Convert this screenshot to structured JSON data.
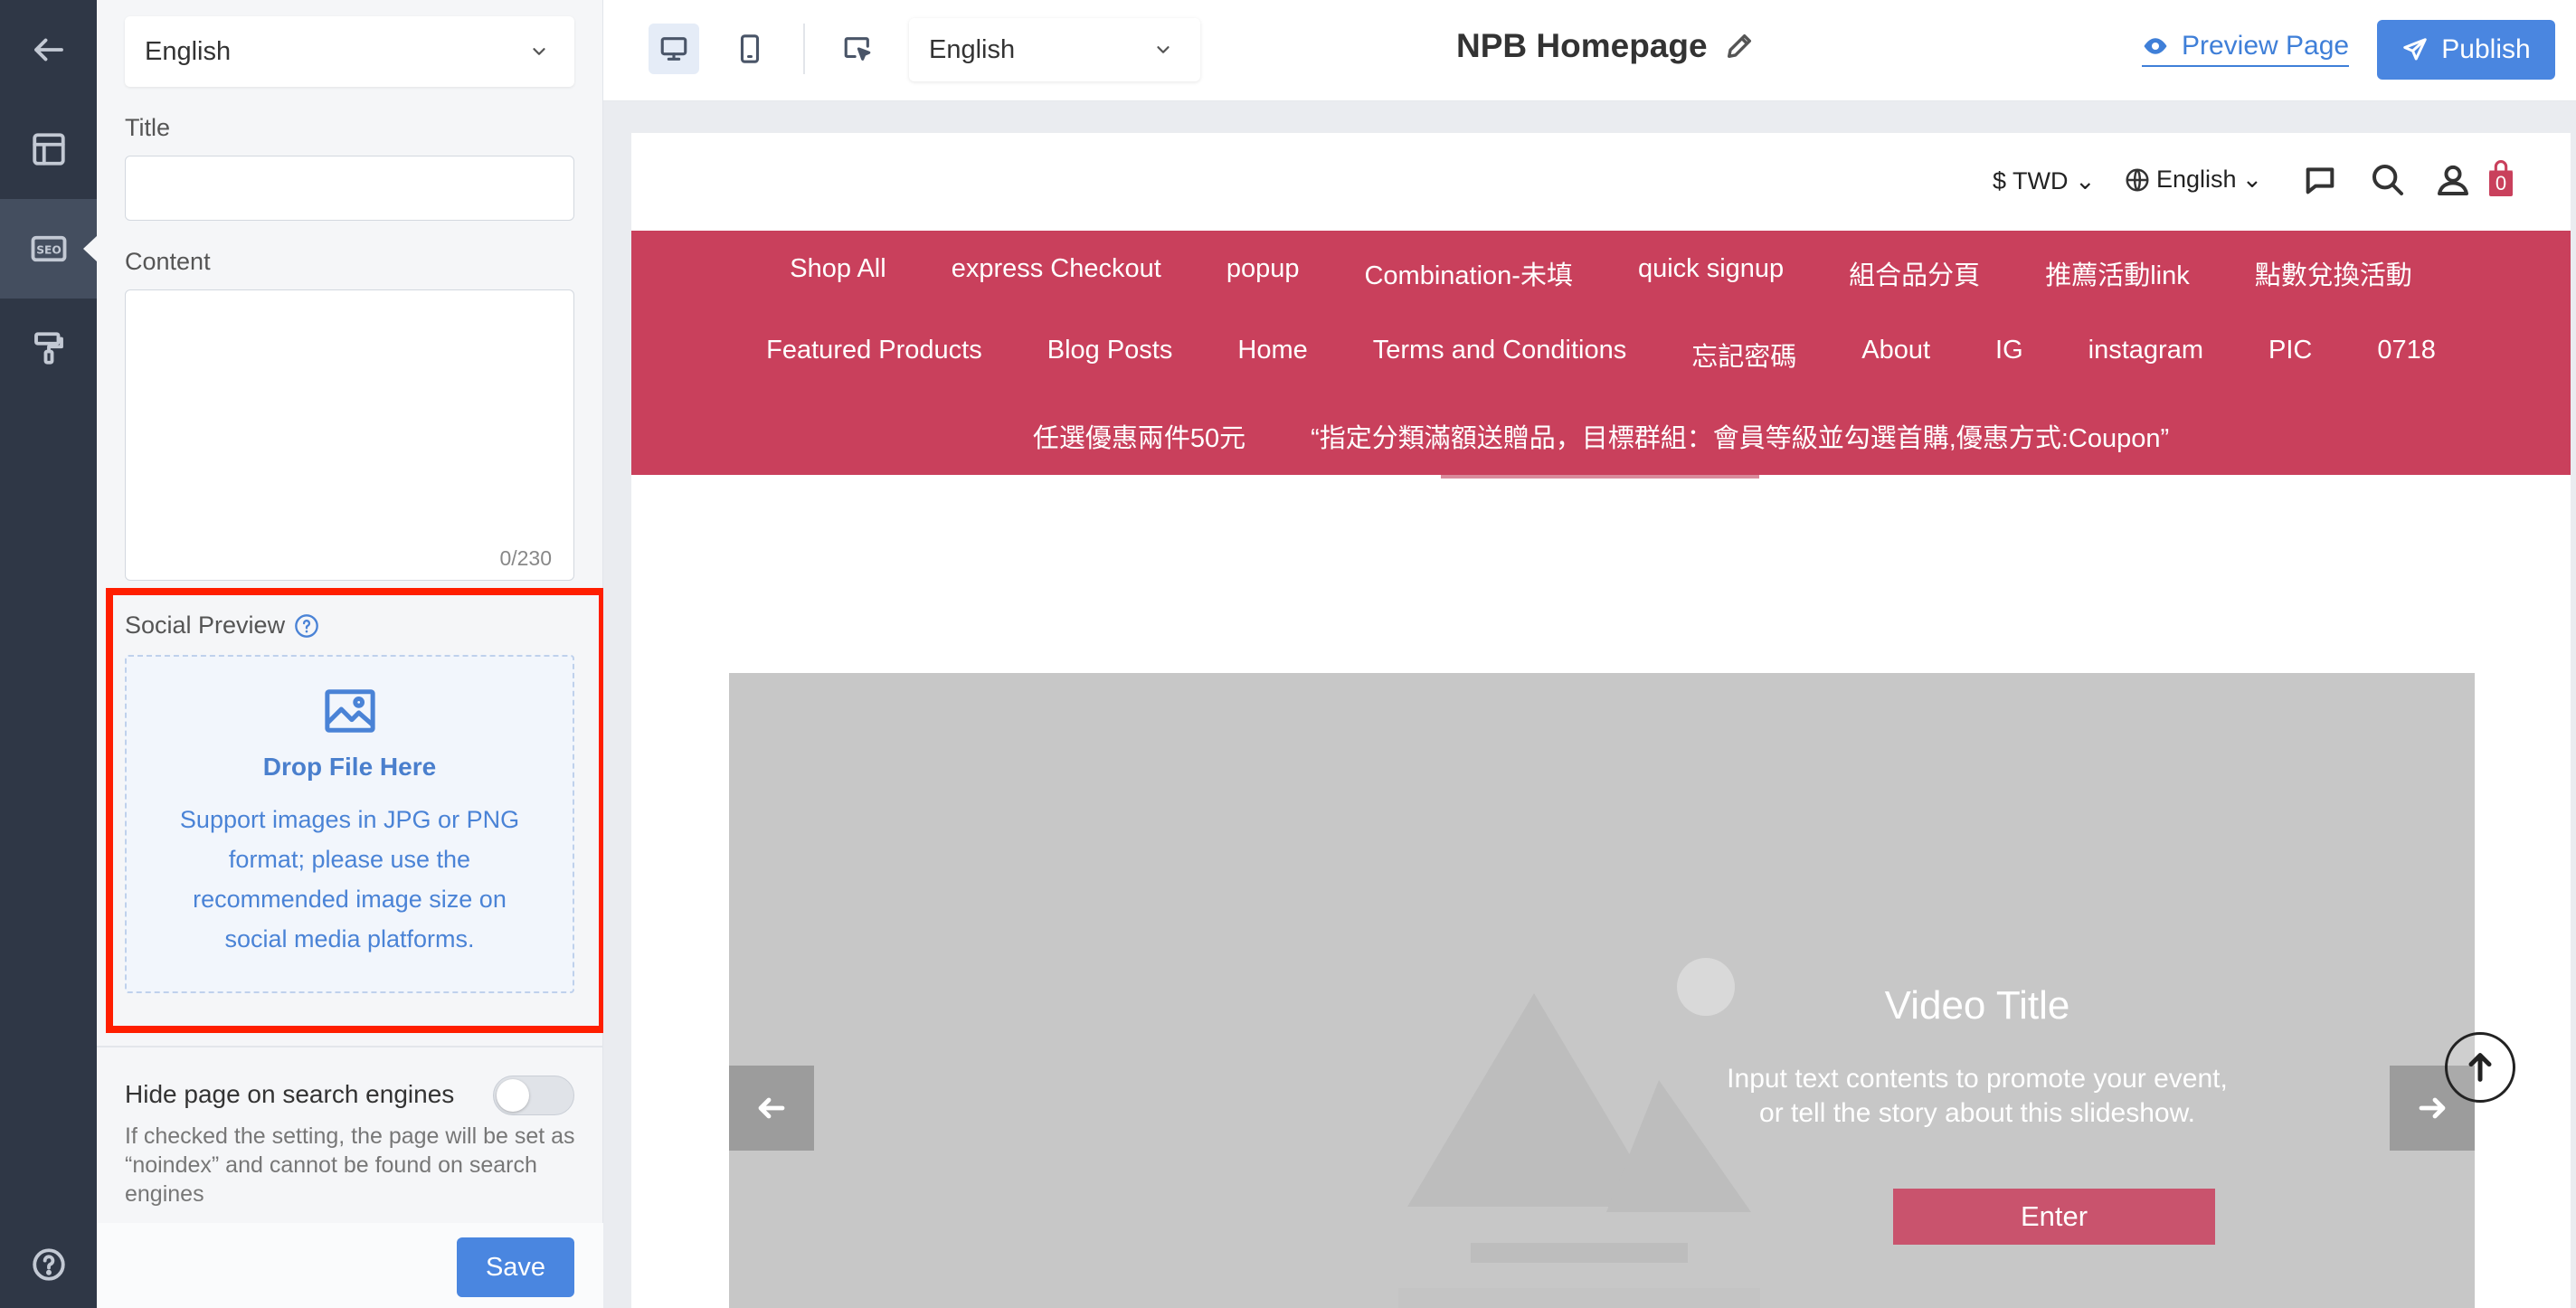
{
  "rail": {
    "items": [
      {
        "name": "back-icon"
      },
      {
        "name": "layout-icon"
      },
      {
        "name": "seo-icon",
        "active": true
      },
      {
        "name": "paint-roller-icon"
      },
      {
        "name": "help-icon"
      }
    ],
    "seo_badge": "SEO"
  },
  "panel": {
    "language_select": "English",
    "title_label": "Title",
    "title_value": "",
    "content_label": "Content",
    "content_value": "",
    "content_counter": "0/230",
    "social_preview": {
      "label": "Social Preview",
      "drop_title": "Drop File Here",
      "drop_desc": "Support images in JPG or PNG format; please use the recommended image size on social media platforms."
    },
    "hide_search": {
      "label": "Hide page on search engines",
      "enabled": false,
      "description": "If checked the setting, the page will be set as “noindex” and cannot be found on search engines"
    },
    "save_label": "Save"
  },
  "topbar": {
    "language_select": "English",
    "page_title": "NPB Homepage",
    "preview_label": "Preview Page",
    "publish_label": "Publish",
    "accent_color": "#4a86e0"
  },
  "site": {
    "currency": "$ TWD",
    "language": "English",
    "cart_count": "0",
    "nav_color": "#c9405c",
    "nav_rows": [
      [
        "Shop All",
        "express Checkout",
        "popup",
        "Combination-未填",
        "quick signup",
        "組合品分頁",
        "推薦活動link",
        "點數兌換活動"
      ],
      [
        "Featured Products",
        "Blog Posts",
        "Home",
        "Terms and Conditions",
        "忘記密碼",
        "About",
        "IG",
        "instagram",
        "PIC",
        "0718"
      ],
      [
        "任選優惠兩件50元",
        "“指定分類滿額送贈品，目標群組：會員等級並勾選首購,優惠方式:Coupon”"
      ]
    ],
    "slide": {
      "title": "Video Title",
      "description_line1": "Input text contents to promote your event,",
      "description_line2": "or tell the story about this slideshow.",
      "button_label": "Enter"
    }
  }
}
